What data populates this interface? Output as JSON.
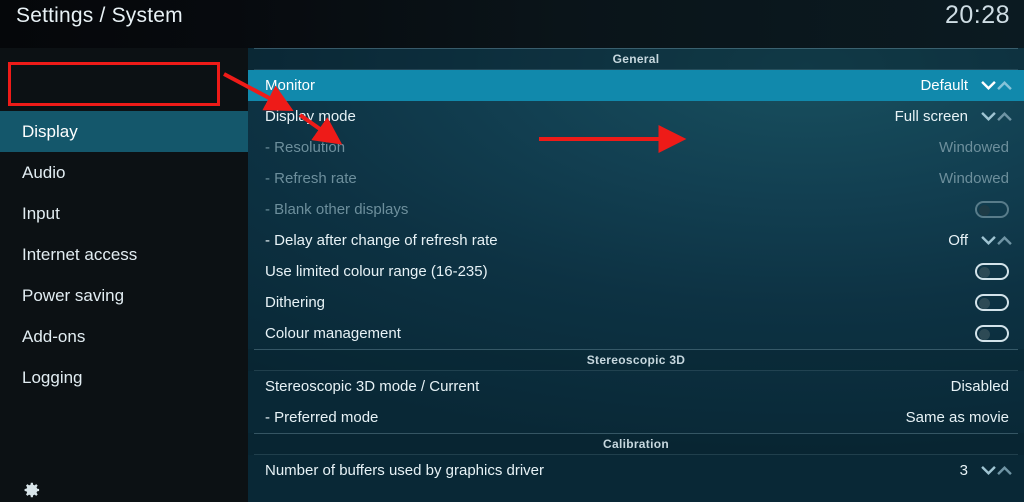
{
  "header": {
    "title": "Settings / System",
    "clock": "20:28"
  },
  "sidebar": {
    "items": [
      {
        "label": "Display",
        "selected": true
      },
      {
        "label": "Audio",
        "selected": false
      },
      {
        "label": "Input",
        "selected": false
      },
      {
        "label": "Internet access",
        "selected": false
      },
      {
        "label": "Power saving",
        "selected": false
      },
      {
        "label": "Add-ons",
        "selected": false
      },
      {
        "label": "Logging",
        "selected": false
      }
    ]
  },
  "content": {
    "groups": [
      {
        "title": "General",
        "rows": [
          {
            "label": "Monitor",
            "value": "Default",
            "control": "spinner",
            "selected": true,
            "disabled": false
          },
          {
            "label": "Display mode",
            "value": "Full screen",
            "control": "spinner",
            "selected": false,
            "disabled": false
          },
          {
            "label": "- Resolution",
            "value": "Windowed",
            "control": "text",
            "selected": false,
            "disabled": true
          },
          {
            "label": "- Refresh rate",
            "value": "Windowed",
            "control": "text",
            "selected": false,
            "disabled": true
          },
          {
            "label": "- Blank other displays",
            "value": "",
            "control": "toggle",
            "toggle_on": false,
            "selected": false,
            "disabled": true
          },
          {
            "label": "- Delay after change of refresh rate",
            "value": "Off",
            "control": "spinner",
            "selected": false,
            "disabled": false
          },
          {
            "label": "Use limited colour range (16-235)",
            "value": "",
            "control": "toggle",
            "toggle_on": false,
            "selected": false,
            "disabled": false
          },
          {
            "label": "Dithering",
            "value": "",
            "control": "toggle",
            "toggle_on": false,
            "selected": false,
            "disabled": false
          },
          {
            "label": "Colour management",
            "value": "",
            "control": "toggle",
            "toggle_on": false,
            "selected": false,
            "disabled": false
          }
        ]
      },
      {
        "title": "Stereoscopic 3D",
        "rows": [
          {
            "label": "Stereoscopic 3D mode / Current",
            "value": "Disabled",
            "control": "text",
            "selected": false,
            "disabled": false
          },
          {
            "label": "- Preferred mode",
            "value": "Same as movie",
            "control": "text",
            "selected": false,
            "disabled": false
          }
        ]
      },
      {
        "title": "Calibration",
        "rows": [
          {
            "label": "Number of buffers used by graphics driver",
            "value": "3",
            "control": "spinner",
            "selected": false,
            "disabled": false
          }
        ]
      }
    ]
  },
  "footer": {
    "gear_label": ""
  },
  "annotations": {
    "highlight_color": "#ee1b18",
    "box_target": "sidebar-item-display",
    "arrow_1_target": "Monitor",
    "arrow_2_target": "Display mode",
    "arrow_3_target": "Display mode value"
  },
  "colors": {
    "selection_blue": "#1189ac",
    "sidebar_selection": "#14576b",
    "panel_bg": "#0d3243",
    "annotation_red": "#ee1b18"
  }
}
